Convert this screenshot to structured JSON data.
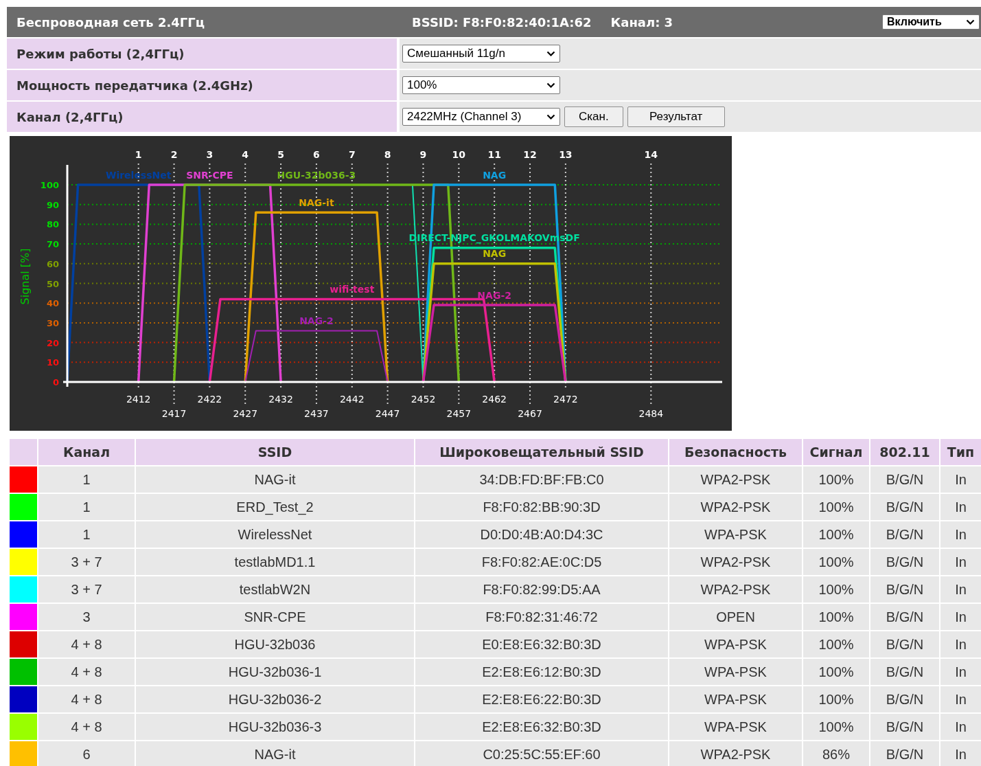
{
  "wireless": {
    "title": "Беспроводная сеть 2.4ГГц",
    "bssid": "BSSID: F8:F0:82:40:1A:62",
    "channel": "Канал: 3",
    "state_select": "Включить",
    "settings": [
      {
        "label": "Режим работы (2,4ГГц)",
        "value": "Смешанный 11g/n"
      },
      {
        "label": "Мощность передатчика (2.4GHz)",
        "value": "100%"
      },
      {
        "label": "Канал (2,4ГГц)",
        "value": "2422MHz (Channel 3)",
        "buttons": [
          "Скан.",
          "Результат"
        ]
      }
    ]
  },
  "scan_chart": {
    "channels": [
      "1",
      "2",
      "3",
      "4",
      "5",
      "6",
      "7",
      "8",
      "9",
      "10",
      "11",
      "12",
      "13",
      "14"
    ],
    "chart_data": {
      "type": "line",
      "ylabel": "Signal [%]",
      "xlim": [
        2402,
        2494
      ],
      "ylim": [
        0,
        100
      ],
      "grid": true,
      "xticks": [
        2412,
        2422,
        2432,
        2442,
        2452,
        2462,
        2472
      ],
      "annotations": [
        "2417",
        "2427",
        "2437",
        "2447",
        "2457",
        "2467",
        "2484"
      ],
      "yticks": [
        0,
        10,
        20,
        30,
        40,
        50,
        60,
        70,
        80,
        90,
        100
      ],
      "series": [
        {
          "name": "WirelessNet",
          "color": "#0040a0",
          "x": [
            2402,
            2403.5,
            2420.5,
            2422
          ],
          "values": [
            0,
            100,
            100,
            0
          ]
        },
        {
          "color": "#10e0b0",
          "x": [
            2450.5,
            2452
          ],
          "values": [
            100,
            0
          ]
        },
        {
          "name": "SNR-CPE",
          "color": "#e040d0",
          "x": [
            2412,
            2413.5,
            2430.5,
            2432
          ],
          "values": [
            0,
            100,
            100,
            0
          ]
        },
        {
          "name": "HGU-32b036-3",
          "color": "#70b818",
          "x": [
            2417,
            2418.5,
            2455.5,
            2457
          ],
          "values": [
            0,
            100,
            100,
            0
          ]
        },
        {
          "name": "NAG-it",
          "color": "#e0a000",
          "x": [
            2427,
            2428.5,
            2445.5,
            2447
          ],
          "values": [
            0,
            86,
            86,
            0
          ]
        },
        {
          "name": "wifi-test",
          "color": "#e8208f",
          "x": [
            2422,
            2423.5,
            2460.5,
            2462
          ],
          "values": [
            0,
            42,
            42,
            0
          ]
        },
        {
          "name": "NAG-2",
          "color": "#a020b0",
          "x": [
            2427,
            2428.5,
            2445.5,
            2447
          ],
          "values": [
            0,
            26,
            26,
            0
          ]
        },
        {
          "name": "NAG",
          "color": "#10a0e0",
          "x": [
            2452,
            2453.5,
            2470.5,
            2472
          ],
          "values": [
            0,
            100,
            100,
            0
          ]
        },
        {
          "name": "DIRECT-NJPC_GKOLMAKOVmsDF",
          "color": "#00e0a0",
          "x": [
            2452,
            2453.5,
            2470.5,
            2472
          ],
          "values": [
            0,
            68,
            68,
            0
          ]
        },
        {
          "name": "NAG",
          "color": "#c0c000",
          "x": [
            2452,
            2453.5,
            2470.5,
            2472
          ],
          "values": [
            0,
            60,
            60,
            0
          ]
        },
        {
          "name": "NAG-2",
          "color": "#d020a0",
          "x": [
            2452,
            2453.5,
            2470.5,
            2472
          ],
          "values": [
            0,
            39,
            39,
            0
          ]
        }
      ]
    }
  },
  "networks": {
    "columns": [
      "Канал",
      "SSID",
      "Широковещательный SSID",
      "Безопасность",
      "Сигнал",
      "802.11",
      "Тип"
    ],
    "rows": [
      {
        "color": "#ff0000",
        "cells": [
          "1",
          "NAG-it",
          "34:DB:FD:BF:FB:C0",
          "WPA2-PSK",
          "100%",
          "B/G/N",
          "In"
        ]
      },
      {
        "color": "#00ff00",
        "cells": [
          "1",
          "ERD_Test_2",
          "F8:F0:82:BB:90:3D",
          "WPA2-PSK",
          "100%",
          "B/G/N",
          "In"
        ]
      },
      {
        "color": "#0000ff",
        "cells": [
          "1",
          "WirelessNet",
          "D0:D0:4B:A0:D4:3C",
          "WPA-PSK",
          "100%",
          "B/G/N",
          "In"
        ]
      },
      {
        "color": "#ffff00",
        "cells": [
          "3 + 7",
          "testlabMD1.1",
          "F8:F0:82:AE:0C:D5",
          "WPA2-PSK",
          "100%",
          "B/G/N",
          "In"
        ]
      },
      {
        "color": "#00ffff",
        "cells": [
          "3 + 7",
          "testlabW2N",
          "F8:F0:82:99:D5:AA",
          "WPA2-PSK",
          "100%",
          "B/G/N",
          "In"
        ]
      },
      {
        "color": "#ff00ff",
        "cells": [
          "3",
          "SNR-CPE",
          "F8:F0:82:31:46:72",
          "OPEN",
          "100%",
          "B/G/N",
          "In"
        ]
      },
      {
        "color": "#dd0000",
        "cells": [
          "4 + 8",
          "HGU-32b036",
          "E0:E8:E6:32:B0:3D",
          "WPA-PSK",
          "100%",
          "B/G/N",
          "In"
        ]
      },
      {
        "color": "#00c000",
        "cells": [
          "4 + 8",
          "HGU-32b036-1",
          "E2:E8:E6:12:B0:3D",
          "WPA-PSK",
          "100%",
          "B/G/N",
          "In"
        ]
      },
      {
        "color": "#0000c0",
        "cells": [
          "4 + 8",
          "HGU-32b036-2",
          "E2:E8:E6:22:B0:3D",
          "WPA-PSK",
          "100%",
          "B/G/N",
          "In"
        ]
      },
      {
        "color": "#99ff00",
        "cells": [
          "4 + 8",
          "HGU-32b036-3",
          "E2:E8:E6:32:B0:3D",
          "WPA-PSK",
          "100%",
          "B/G/N",
          "In"
        ]
      },
      {
        "color": "#ffc000",
        "cells": [
          "6",
          "NAG-it",
          "C0:25:5C:55:EF:60",
          "WPA2-PSK",
          "86%",
          "B/G/N",
          "In"
        ]
      }
    ]
  }
}
